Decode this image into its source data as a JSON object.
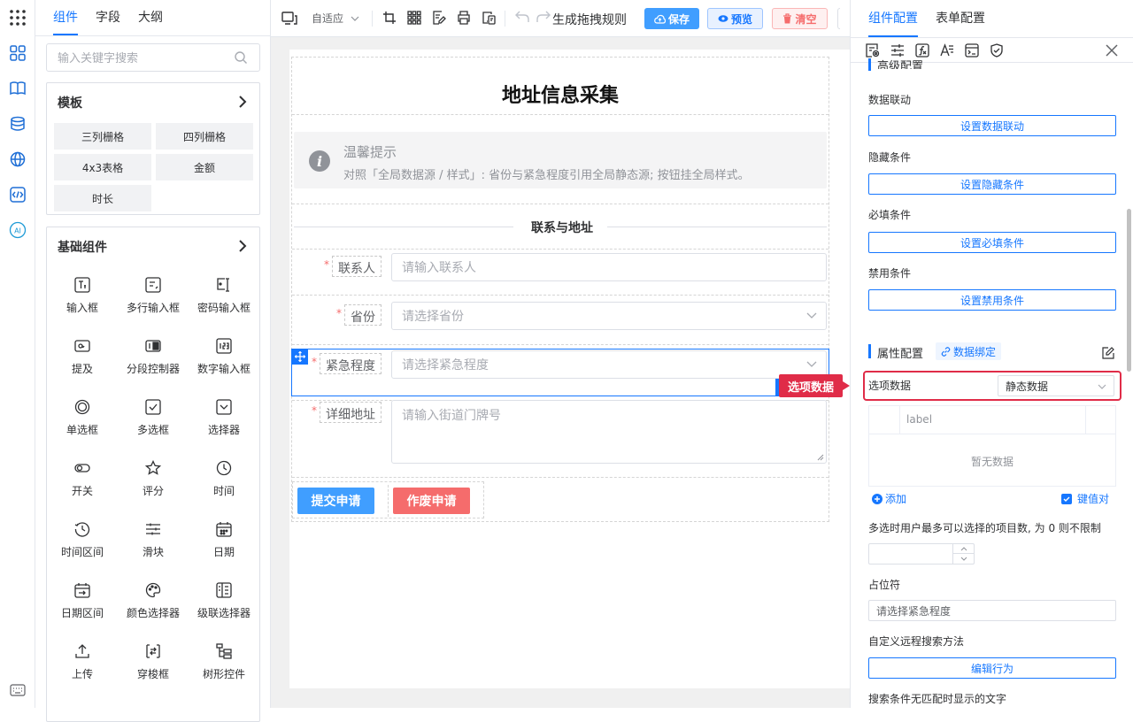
{
  "left_panel": {
    "tabs": [
      "组件",
      "字段",
      "大纲"
    ],
    "search_placeholder": "输入关键字搜索",
    "templates": {
      "title": "模板",
      "items": [
        "三列栅格",
        "四列栅格",
        "4x3表格",
        "金额",
        "时长"
      ]
    },
    "basic": {
      "title": "基础组件",
      "items": [
        {
          "label": "输入框",
          "icon": "text-input-icon"
        },
        {
          "label": "多行输入框",
          "icon": "textarea-icon"
        },
        {
          "label": "密码输入框",
          "icon": "password-icon"
        },
        {
          "label": "提及",
          "icon": "mention-icon"
        },
        {
          "label": "分段控制器",
          "icon": "segmented-icon"
        },
        {
          "label": "数字输入框",
          "icon": "number-icon"
        },
        {
          "label": "单选框",
          "icon": "radio-icon"
        },
        {
          "label": "多选框",
          "icon": "checkbox-icon"
        },
        {
          "label": "选择器",
          "icon": "select-icon"
        },
        {
          "label": "开关",
          "icon": "switch-icon"
        },
        {
          "label": "评分",
          "icon": "star-icon"
        },
        {
          "label": "时间",
          "icon": "clock-icon"
        },
        {
          "label": "时间区间",
          "icon": "time-range-icon"
        },
        {
          "label": "滑块",
          "icon": "slider-icon"
        },
        {
          "label": "日期",
          "icon": "calendar-icon"
        },
        {
          "label": "日期区间",
          "icon": "date-range-icon"
        },
        {
          "label": "颜色选择器",
          "icon": "palette-icon"
        },
        {
          "label": "级联选择器",
          "icon": "cascader-icon"
        },
        {
          "label": "上传",
          "icon": "upload-icon"
        },
        {
          "label": "穿梭框",
          "icon": "transfer-icon"
        },
        {
          "label": "树形控件",
          "icon": "tree-icon"
        }
      ]
    }
  },
  "toolbar": {
    "adaptive": "自适应",
    "rules": "生成拖拽规则",
    "save": "保存",
    "preview": "预览",
    "clear": "清空"
  },
  "form": {
    "title": "地址信息采集",
    "alert_title": "温馨提示",
    "alert_desc": "对照「全局数据源 / 样式」: 省份与紧急程度引用全局静态源; 按钮挂全局样式。",
    "divider": "联系与地址",
    "fields": [
      {
        "label": "联系人",
        "placeholder": "请输入联系人"
      },
      {
        "label": "省份",
        "placeholder": "请选择省份"
      },
      {
        "label": "紧急程度",
        "placeholder": "请选择紧急程度"
      },
      {
        "label": "详细地址",
        "placeholder": "请输入街道门牌号"
      }
    ],
    "submit": "提交申请",
    "void": "作废申请"
  },
  "right_panel": {
    "tabs": [
      "组件配置",
      "表单配置"
    ],
    "advanced_title": "高级配置",
    "rows": [
      {
        "label": "数据联动",
        "button": "设置数据联动"
      },
      {
        "label": "隐藏条件",
        "button": "设置隐藏条件"
      },
      {
        "label": "必填条件",
        "button": "设置必填条件"
      },
      {
        "label": "禁用条件",
        "button": "设置禁用条件"
      }
    ],
    "prop_title": "属性配置",
    "data_bind": "数据绑定",
    "option_label": "选项数据",
    "option_value": "静态数据",
    "callout": "选项数据",
    "table_header": "label",
    "empty": "暂无数据",
    "add": "添加",
    "kv": "键值对",
    "multi_limit": "多选时用户最多可以选择的项目数, 为 0 则不限制",
    "placeholder_label": "占位符",
    "placeholder_value": "请选择紧急程度",
    "remote_label": "自定义远程搜索方法",
    "edit_action": "编辑行为",
    "no_match": "搜索条件无匹配时显示的文字"
  },
  "colors": {
    "accent": "#1677ff",
    "danger": "#e02c48",
    "submit": "#409eff",
    "void": "#f56c6c"
  }
}
